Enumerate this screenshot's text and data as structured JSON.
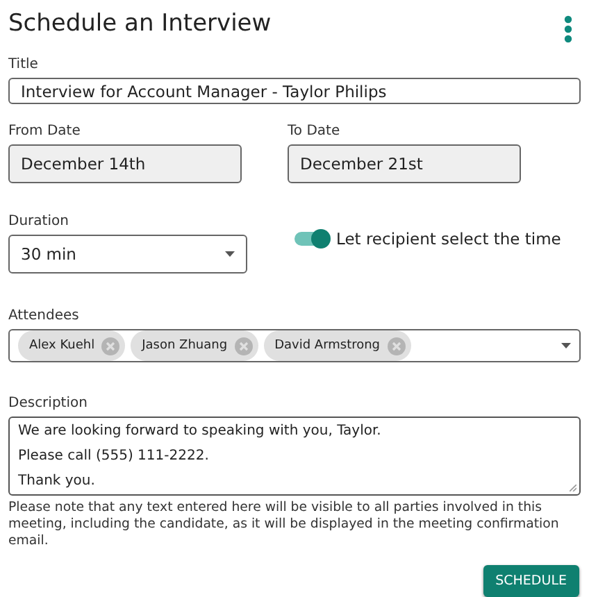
{
  "header": {
    "title": "Schedule an Interview"
  },
  "title_field": {
    "label": "Title",
    "value": "Interview for Account Manager - Taylor Philips"
  },
  "from_date": {
    "label": "From Date",
    "value": "December 14th"
  },
  "to_date": {
    "label": "To Date",
    "value": "December 21st"
  },
  "duration": {
    "label": "Duration",
    "value": "30 min"
  },
  "recipient_toggle": {
    "label": "Let recipient select the time",
    "on": true
  },
  "attendees": {
    "label": "Attendees",
    "chips": [
      "Alex Kuehl",
      "Jason Zhuang",
      "David Armstrong"
    ]
  },
  "description": {
    "label": "Description",
    "lines": [
      "We are looking forward to speaking with you, Taylor.",
      "Please call (555) 111-2222.",
      "Thank you."
    ]
  },
  "note": "Please note that any text entered here will be visible to all parties involved in this meeting, including the candidate, as it will be displayed in the meeting confirmation email.",
  "buttons": [
    "SCHEDULE"
  ]
}
